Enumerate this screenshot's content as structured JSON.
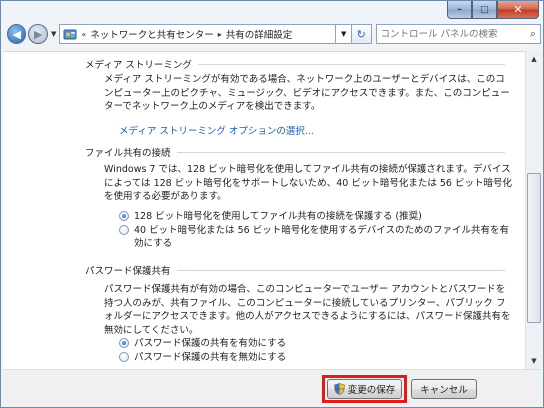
{
  "window": {
    "caption_minimize": "–",
    "caption_maximize": "□",
    "caption_close": "✕"
  },
  "addressbar": {
    "chevron": "«",
    "crumbs": [
      "ネットワークと共有センター",
      "共有の詳細設定"
    ],
    "search_placeholder": "コントロール パネルの検索"
  },
  "sections": [
    {
      "title": "メディア ストリーミング",
      "text": "メディア ストリーミングが有効である場合、ネットワーク上のユーザーとデバイスは、このコンピューター上のピクチャ、ミュージック、ビデオにアクセスできます。また、このコンピューターでネットワーク上のメディアを検出できます。",
      "link": "メディア ストリーミング オプションの選択..."
    },
    {
      "title": "ファイル共有の接続",
      "text": "Windows 7 では、128 ビット暗号化を使用してファイル共有の接続が保護されます。デバイスによっては 128 ビット暗号化をサポートしないため、40 ビット暗号化または 56 ビット暗号化を使用する必要があります。",
      "options": [
        {
          "label": "128 ビット暗号化を使用してファイル共有の接続を保護する (推奨)",
          "checked": true
        },
        {
          "label": "40 ビット暗号化または 56 ビット暗号化を使用するデバイスのためのファイル共有を有効にする",
          "checked": false
        }
      ]
    },
    {
      "title": "パスワード保護共有",
      "text": "パスワード保護共有が有効の場合、このコンピューターでユーザー アカウントとパスワードを持つ人のみが、共有ファイル、このコンピューターに接続しているプリンター、パブリック フォルダーにアクセスできます。他の人がアクセスできるようにするには、パスワード保護共有を無効にしてください。",
      "options": [
        {
          "label": "パスワード保護の共有を有効にする",
          "checked": true
        },
        {
          "label": "パスワード保護の共有を無効にする",
          "checked": false
        }
      ]
    }
  ],
  "footer": {
    "save_label": "変更の保存",
    "cancel_label": "キャンセル"
  },
  "colors": {
    "link": "#1a5fb4",
    "highlight": "#e11a1a"
  }
}
